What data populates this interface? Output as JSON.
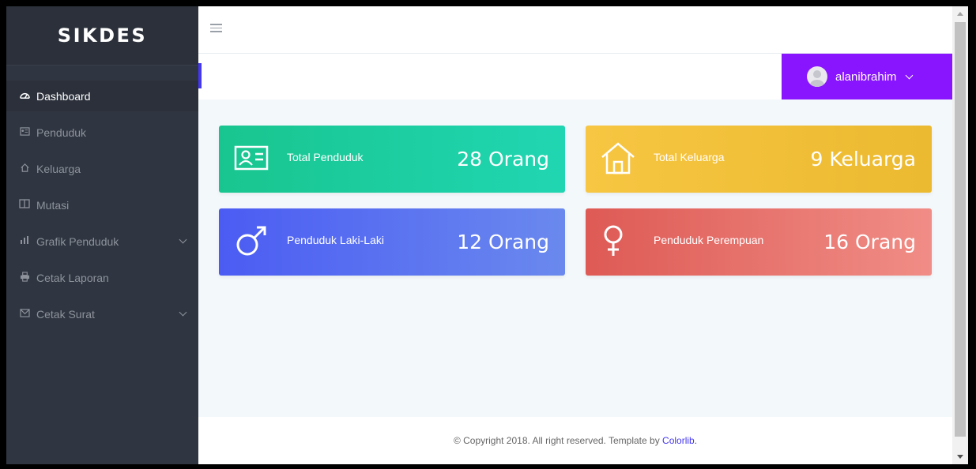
{
  "brand": "SIKDES",
  "sidebar": {
    "items": [
      {
        "label": "Dashboard",
        "icon": "dashboard-icon",
        "active": true
      },
      {
        "label": "Penduduk",
        "icon": "id-card-icon"
      },
      {
        "label": "Keluarga",
        "icon": "home-icon"
      },
      {
        "label": "Mutasi",
        "icon": "book-icon"
      },
      {
        "label": "Grafik Penduduk",
        "icon": "bar-chart-icon",
        "has_submenu": true
      },
      {
        "label": "Cetak Laporan",
        "icon": "printer-icon"
      },
      {
        "label": "Cetak Surat",
        "icon": "mail-icon",
        "has_submenu": true
      }
    ]
  },
  "header": {
    "menu_icon": "hamburger-icon"
  },
  "user": {
    "name": "alanibrahim",
    "icon": "avatar-icon"
  },
  "cards": [
    {
      "label": "Total Penduduk",
      "value": "28 Orang",
      "icon": "id-card-icon",
      "color": "#1dcf9f"
    },
    {
      "label": "Total Keluarga",
      "value": "9 Keluarga",
      "icon": "home-icon",
      "color": "#f2c03a"
    },
    {
      "label": "Penduduk Laki-Laki",
      "value": "12 Orang",
      "icon": "male-icon",
      "color": "#5a6ff0"
    },
    {
      "label": "Penduduk Perempuan",
      "value": "16 Orang",
      "icon": "female-icon",
      "color": "#e66e68"
    }
  ],
  "footer": {
    "text": "© Copyright 2018. All right reserved. Template by ",
    "link": "Colorlib."
  },
  "colors": {
    "sidebar": "#303641",
    "accent": "#8914fe"
  }
}
